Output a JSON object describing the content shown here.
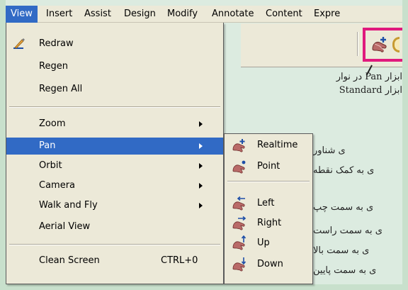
{
  "menubar": {
    "items": [
      "View",
      "Insert",
      "Assist",
      "Design",
      "Modify",
      "Annotate",
      "Content",
      "Expre"
    ],
    "active_index": 0
  },
  "view_menu": {
    "items": [
      {
        "label": "Redraw",
        "icon": "redraw-icon"
      },
      {
        "label": "Regen"
      },
      {
        "label": "Regen All"
      },
      {
        "label": "Zoom",
        "submenu": true
      },
      {
        "label": "Pan",
        "submenu": true,
        "highlighted": true
      },
      {
        "label": "Orbit",
        "submenu": true
      },
      {
        "label": "Camera",
        "submenu": true
      },
      {
        "label": "Walk and Fly",
        "submenu": true
      },
      {
        "label": "Aerial View"
      },
      {
        "label": "Clean Screen",
        "shortcut": "CTRL+0"
      }
    ]
  },
  "pan_submenu": {
    "items": [
      {
        "label": "Realtime",
        "icon": "pan-realtime-icon"
      },
      {
        "label": "Point",
        "icon": "pan-point-icon"
      },
      {
        "label": "Left",
        "icon": "pan-left-icon"
      },
      {
        "label": "Right",
        "icon": "pan-right-icon"
      },
      {
        "label": "Up",
        "icon": "pan-up-icon"
      },
      {
        "label": "Down",
        "icon": "pan-down-icon"
      }
    ]
  },
  "caption": {
    "line1": "ابزار Pan در نوار",
    "line2": "ابزار Standard"
  },
  "descriptions": {
    "realtime": "ی شناور",
    "point": "ی به کمک نقطه",
    "left": "ی به سمت چپ",
    "right": "ی به سمت راست",
    "up": "ی به سمت بالا",
    "down": "ی به سمت پایین"
  },
  "colors": {
    "highlight": "#316ac5",
    "callout_border": "#e0197d",
    "menu_bg": "#ece9d8",
    "page_border": "#c8e0cc"
  }
}
